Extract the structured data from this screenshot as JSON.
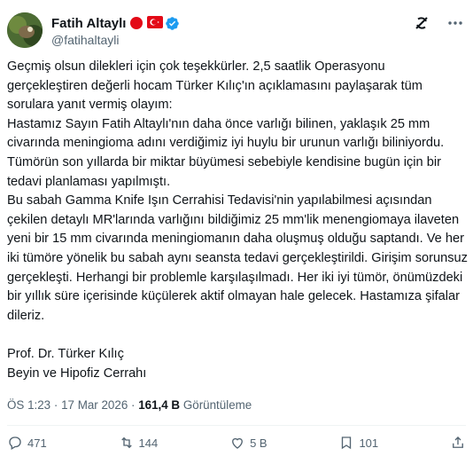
{
  "author": {
    "name": "Fatih Altaylı",
    "handle": "@fatihaltayli"
  },
  "post": {
    "paragraphs": [
      "Geçmiş olsun dilekleri için çok teşekkürler. 2,5 saatlik Operasyonu gerçekleştiren değerli hocam Türker Kılıç'ın açıklamasını paylaşarak tüm sorulara yanıt vermiş olayım:",
      "Hastamız Sayın Fatih Altaylı'nın daha önce varlığı bilinen, yaklaşık 25 mm civarında meningioma adını verdiğimiz iyi huylu bir urunun varlığı biliniyordu. Tümörün son yıllarda bir miktar büyümesi sebebiyle kendisine bugün için bir tedavi planlaması yapılmıştı.",
      "Bu sabah Gamma Knife Işın Cerrahisi Tedavisi'nin yapılabilmesi açısından çekilen detaylı MR'larında varlığını bildiğimiz 25 mm'lik menengiomaya ilaveten yeni bir 15 mm civarında meningiomanın daha oluşmuş olduğu saptandı. Ve her iki tümöre yönelik bu sabah aynı seansta tedavi gerçekleştirildi. Girişim sorunsuz gerçekleşti. Herhangi bir problemle karşılaşılmadı. Her iki iyi tümör, önümüzdeki bir yıllık süre içerisinde küçülerek aktif olmayan hale gelecek. Hastamıza şifalar dileriz."
    ],
    "signature_name": "Prof. Dr. Türker Kılıç",
    "signature_title": "Beyin ve Hipofiz Cerrahı"
  },
  "meta": {
    "time": "ÖS 1:23",
    "separator": "·",
    "date": "17 Mar 2026",
    "views_count": "161,4 B",
    "views_label": "Görüntüleme"
  },
  "actions": {
    "replies": "471",
    "reposts": "144",
    "likes": "5 B",
    "bookmarks": "101"
  },
  "icons": {
    "verified": "verified-badge-icon",
    "flag1": "red-circle-icon",
    "flag2": "turkey-flag-icon",
    "grok": "grok-icon",
    "more": "more-icon"
  },
  "colors": {
    "verified": "#1d9bf0",
    "flag_red": "#e30a17",
    "muted": "#536471"
  }
}
